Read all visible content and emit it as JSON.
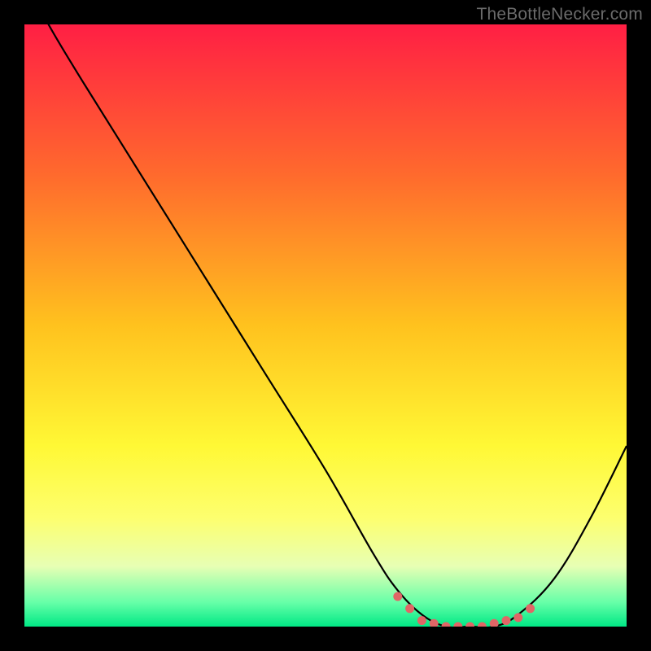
{
  "watermark": "TheBottleNecker.com",
  "chart_data": {
    "type": "line",
    "title": "",
    "xlabel": "",
    "ylabel": "",
    "xlim": [
      0,
      100
    ],
    "ylim": [
      0,
      100
    ],
    "gradient_stops": [
      {
        "offset": 0,
        "color": "#ff1f44"
      },
      {
        "offset": 0.25,
        "color": "#ff6a2d"
      },
      {
        "offset": 0.5,
        "color": "#ffc21e"
      },
      {
        "offset": 0.7,
        "color": "#fff835"
      },
      {
        "offset": 0.82,
        "color": "#fdff6f"
      },
      {
        "offset": 0.9,
        "color": "#e7ffb4"
      },
      {
        "offset": 0.96,
        "color": "#66ffa8"
      },
      {
        "offset": 1.0,
        "color": "#00e885"
      }
    ],
    "series": [
      {
        "name": "bottleneck-curve",
        "x": [
          0,
          4,
          10,
          20,
          30,
          40,
          50,
          58,
          62,
          66,
          70,
          74,
          78,
          82,
          88,
          94,
          100
        ],
        "y": [
          108,
          100,
          90,
          74,
          58,
          42,
          26,
          12,
          6,
          2,
          0,
          0,
          0,
          2,
          8,
          18,
          30
        ]
      }
    ],
    "markers": {
      "name": "highlight-dots",
      "color": "#e06666",
      "x": [
        62,
        64,
        66,
        68,
        70,
        72,
        74,
        76,
        78,
        80,
        82,
        84
      ],
      "y": [
        5,
        3,
        1,
        0.5,
        0,
        0,
        0,
        0,
        0.5,
        1,
        1.5,
        3
      ]
    }
  }
}
